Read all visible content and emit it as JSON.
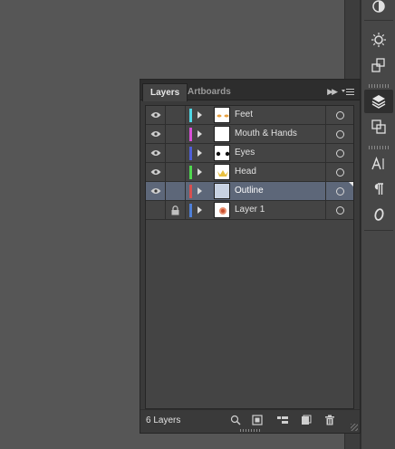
{
  "tabs": {
    "layers": "Layers",
    "artboards": "Artboards"
  },
  "layers": [
    {
      "name": "Feet",
      "color": "#4fd8e6",
      "visible": true,
      "locked": false,
      "selected": false,
      "thumb": "feet"
    },
    {
      "name": "Mouth & Hands",
      "color": "#d84fd8",
      "visible": true,
      "locked": false,
      "selected": false,
      "thumb": "blank"
    },
    {
      "name": "Eyes",
      "color": "#4f5fd8",
      "visible": true,
      "locked": false,
      "selected": false,
      "thumb": "eyes"
    },
    {
      "name": "Head",
      "color": "#4fd84f",
      "visible": true,
      "locked": false,
      "selected": false,
      "thumb": "head"
    },
    {
      "name": "Outline",
      "color": "#d84f4f",
      "visible": true,
      "locked": false,
      "selected": true,
      "thumb": "blank"
    },
    {
      "name": "Layer 1",
      "color": "#4f7fd8",
      "visible": false,
      "locked": true,
      "selected": false,
      "thumb": "layer1"
    }
  ],
  "footer": {
    "count": "6 Layers"
  },
  "icons": {
    "dock": [
      "appearance-icon",
      "symbols-icon",
      "transform-icon",
      "layers-icon",
      "artboard-icon",
      "character-icon",
      "paragraph-icon",
      "opentype-icon"
    ],
    "footer": [
      "locate-object-icon",
      "make-clipping-mask-icon",
      "create-sublayer-icon",
      "create-layer-icon",
      "trash-icon"
    ]
  },
  "colors": {
    "selection": "#5d6779",
    "panel_bg": "#444444"
  }
}
